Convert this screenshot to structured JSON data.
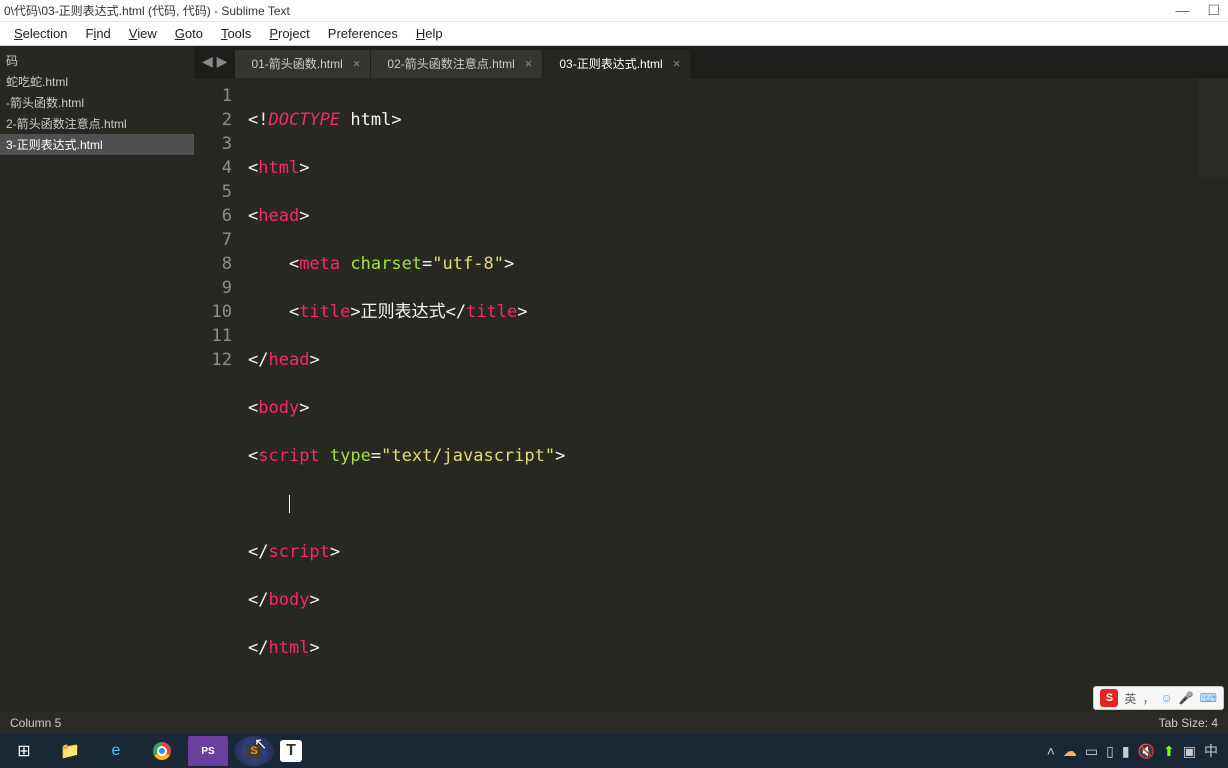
{
  "window": {
    "title": "0\\代码\\03-正则表达式.html (代码, 代码) - Sublime Text"
  },
  "menu": {
    "items": [
      "Selection",
      "Find",
      "View",
      "Goto",
      "Tools",
      "Project",
      "Preferences",
      "Help"
    ]
  },
  "sidebar": {
    "items": [
      {
        "label": "码",
        "selected": false
      },
      {
        "label": "蛇吃蛇.html",
        "selected": false
      },
      {
        "label": "-箭头函数.html",
        "selected": false
      },
      {
        "label": "2-箭头函数注意点.html",
        "selected": false
      },
      {
        "label": "3-正则表达式.html",
        "selected": true
      }
    ]
  },
  "tabs": {
    "items": [
      {
        "label": "01-箭头函数.html",
        "active": false
      },
      {
        "label": "02-箭头函数注意点.html",
        "active": false
      },
      {
        "label": "03-正则表达式.html",
        "active": true
      }
    ]
  },
  "code": {
    "lines": [
      "1",
      "2",
      "3",
      "4",
      "5",
      "6",
      "7",
      "8",
      "9",
      "10",
      "11",
      "12"
    ],
    "l1": {
      "a": "<!",
      "b": "DOCTYPE",
      "c": " html",
      "d": ">"
    },
    "l2": {
      "a": "<",
      "b": "html",
      "c": ">"
    },
    "l3": {
      "a": "<",
      "b": "head",
      "c": ">"
    },
    "l4": {
      "a": "    <",
      "b": "meta",
      "c": " ",
      "d": "charset",
      "e": "=",
      "f": "\"utf-8\"",
      "g": ">"
    },
    "l5": {
      "a": "    <",
      "b": "title",
      "c": ">",
      "d": "正则表达式",
      "e": "</",
      "f": "title",
      "g": ">"
    },
    "l6": {
      "a": "</",
      "b": "head",
      "c": ">"
    },
    "l7": {
      "a": "<",
      "b": "body",
      "c": ">"
    },
    "l8": {
      "a": "<",
      "b": "script",
      "c": " ",
      "d": "type",
      "e": "=",
      "f": "\"text/javascript\"",
      "g": ">"
    },
    "l9": {
      "a": "    "
    },
    "l10": {
      "a": "</",
      "b": "script",
      "c": ">"
    },
    "l11": {
      "a": "</",
      "b": "body",
      "c": ">"
    },
    "l12": {
      "a": "</",
      "b": "html",
      "c": ">"
    }
  },
  "statusbar": {
    "left": "Column 5",
    "right": "Tab Size: 4"
  },
  "ime": {
    "lang": "英",
    "comma": "，",
    "dot": "。"
  },
  "taskbar": {
    "lang": "中"
  }
}
